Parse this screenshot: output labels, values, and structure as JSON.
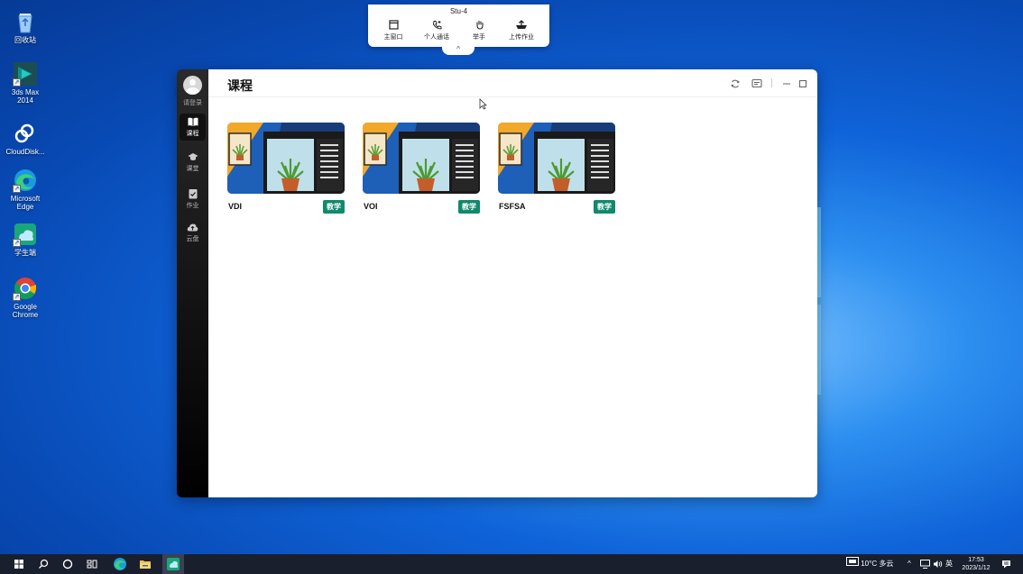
{
  "desktop": {
    "icons": [
      {
        "label": "回收站"
      },
      {
        "label": "3ds Max 2014"
      },
      {
        "label": "CloudDisk..."
      },
      {
        "label": "Microsoft Edge"
      },
      {
        "label": "学生端"
      },
      {
        "label": "Google Chrome"
      }
    ]
  },
  "toolbar": {
    "title": "Stu-4",
    "items": [
      {
        "label": "主窗口",
        "icon": "window-icon"
      },
      {
        "label": "个人通话",
        "icon": "phone-icon"
      },
      {
        "label": "举手",
        "icon": "hand-icon"
      },
      {
        "label": "上传作业",
        "icon": "upload-icon"
      }
    ],
    "collapse": "^"
  },
  "sidebar": {
    "login": "请登录",
    "items": [
      {
        "label": "课程",
        "icon": "book-icon",
        "active": true
      },
      {
        "label": "课堂",
        "icon": "graduation-cap-icon",
        "active": false
      },
      {
        "label": "作业",
        "icon": "assignment-icon",
        "active": false
      },
      {
        "label": "云盘",
        "icon": "cloud-upload-icon",
        "active": false
      }
    ]
  },
  "main": {
    "title": "课程",
    "courses": [
      {
        "name": "VDI",
        "badge": "教学"
      },
      {
        "name": "VOI",
        "badge": "教学"
      },
      {
        "name": "FSFSA",
        "badge": "教学"
      }
    ]
  },
  "taskbar": {
    "weather": "10°C 多云",
    "ime": "英",
    "time": "17:53",
    "date": "2023/1/12"
  },
  "colors": {
    "badge": "#0f8a6c",
    "taskbar": "#1a1f2e",
    "desktop": "#0f63d8"
  }
}
